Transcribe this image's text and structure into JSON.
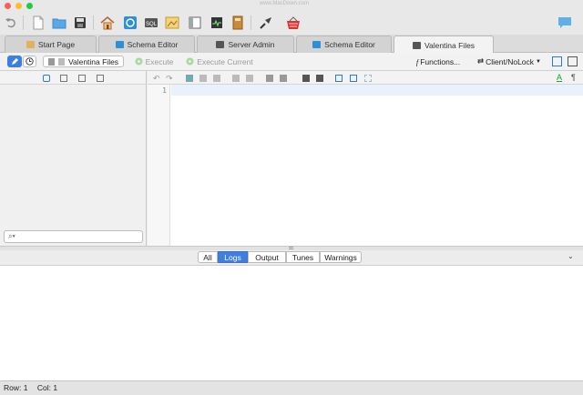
{
  "window": {
    "watermark": "www.MacDown.com"
  },
  "toolbar": {
    "icons": [
      "undo-icon",
      "new-document-icon",
      "open-folder-icon",
      "save-icon",
      "home-icon",
      "schema-editor-icon",
      "sql-icon",
      "image-icon",
      "window-icon",
      "monitor-icon",
      "notebook-icon",
      "connect-icon",
      "basket-icon",
      "chat-icon"
    ]
  },
  "tabs": [
    {
      "label": "Start Page"
    },
    {
      "label": "Schema Editor"
    },
    {
      "label": "Server Admin"
    },
    {
      "label": "Schema Editor"
    },
    {
      "label": "Valentina Files"
    }
  ],
  "subbar": {
    "files_label": "Valentina Files",
    "execute_label": "Execute",
    "execute_current_label": "Execute Current",
    "functions_label": "Functions...",
    "client_label": "Client/NoLock"
  },
  "editor": {
    "line_number": "1"
  },
  "left_panel": {
    "search_placeholder": ""
  },
  "output": {
    "tabs": [
      "All",
      "Logs",
      "Output",
      "Tunes",
      "Warnings"
    ],
    "selected": "Logs"
  },
  "status": {
    "row": "Row: 1",
    "col": "Col: 1"
  },
  "colors": {
    "accent": "#3d7ee0",
    "selection": "#e9f1fb"
  }
}
